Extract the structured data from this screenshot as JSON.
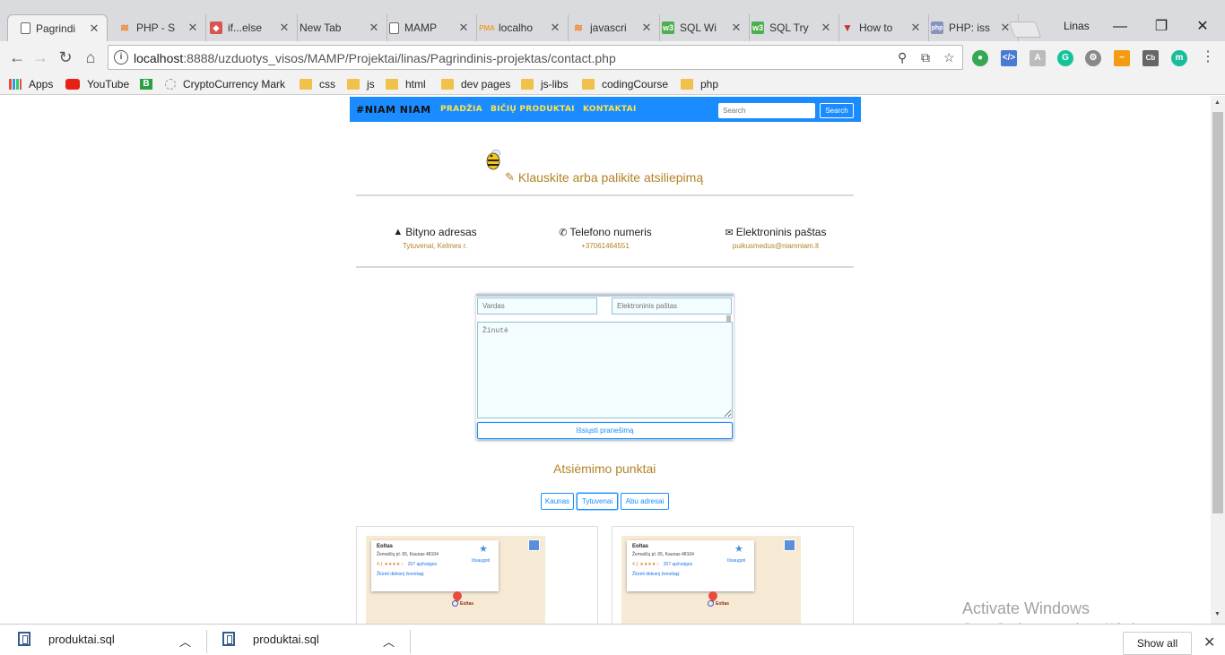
{
  "tabs": [
    {
      "title": "Pagrindi",
      "icon": "page-icon",
      "active": true
    },
    {
      "title": "PHP - S",
      "icon": "stackoverflow-icon"
    },
    {
      "title": "if...else",
      "icon": "bird-icon"
    },
    {
      "title": "New Tab",
      "icon": "none"
    },
    {
      "title": "MAMP",
      "icon": "page-icon"
    },
    {
      "title": "localho",
      "icon": "phpmyadmin-icon"
    },
    {
      "title": "javascri",
      "icon": "stackoverflow-icon"
    },
    {
      "title": "SQL Wi",
      "icon": "w3-icon"
    },
    {
      "title": "SQL Try",
      "icon": "w3-icon"
    },
    {
      "title": "How to",
      "icon": "v-icon"
    },
    {
      "title": "PHP: iss",
      "icon": "php-icon"
    }
  ],
  "window": {
    "user": "Linas",
    "minimize": "—",
    "maximize": "❐",
    "close": "✕"
  },
  "address": {
    "host": "localhost",
    "path": ":8888/uzduotys_visos/MAMP/Projektai/linas/Pagrindinis-projektas/contact.php"
  },
  "bookmarks": [
    {
      "label": "Apps",
      "icon": "apps-icon"
    },
    {
      "label": "YouTube",
      "icon": "youtube-icon"
    },
    {
      "label": "",
      "icon": "b-icon"
    },
    {
      "label": "CryptoCurrency Mark",
      "icon": "crypto-icon"
    },
    {
      "label": "css",
      "icon": "folder-icon"
    },
    {
      "label": "js",
      "icon": "folder-icon"
    },
    {
      "label": "html",
      "icon": "folder-icon"
    },
    {
      "label": "dev pages",
      "icon": "folder-icon"
    },
    {
      "label": "js-libs",
      "icon": "folder-icon"
    },
    {
      "label": "codingCourse",
      "icon": "folder-icon"
    },
    {
      "label": "php",
      "icon": "folder-icon"
    }
  ],
  "site": {
    "brand": "#NIAM NIAM",
    "nav": [
      "PRADŽIA",
      "BIČIŲ PRODUKTAI",
      "KONTAKTAI"
    ],
    "search_placeholder": "Search",
    "search_button": "Search",
    "heading": "Klauskite arba palikite atsiliepimą",
    "info": [
      {
        "label": "Bityno adresas",
        "value": "Tytuvenai, Kelmes r.",
        "icon": "road-icon"
      },
      {
        "label": "Telefono numeris",
        "value": "+37061464551",
        "icon": "phone-icon"
      },
      {
        "label": "Elektroninis paštas",
        "value": "puikusmedus@niamniam.lt",
        "icon": "envelope-icon"
      }
    ],
    "form": {
      "name_placeholder": "Vardas",
      "email_placeholder": "Elektroninis paštas",
      "message_placeholder": "Žinutė",
      "submit": "Išsiųsti pranešimą"
    },
    "pickup_title": "Atsiėmimo punktai",
    "cities": [
      "Kaunas",
      "Tytuvenai",
      "Abu adresai"
    ],
    "selected_city": "Tytuvenai",
    "maps": [
      {
        "name": "Eoltas",
        "address": "Žemaičių pl. 65, Kaunas 48104",
        "rating": "4,1 ★★★★☆",
        "reviews": "207 apžvalgos",
        "save": "Išsaugoti",
        "view": "Žiūrėti didesnį žemėlapį",
        "pin": "Eoltas"
      },
      {
        "name": "Eoltas",
        "address": "Žemaičių pl. 65, Kaunas 48104",
        "rating": "4,1 ★★★★☆",
        "reviews": "207 apžvalgos",
        "save": "Išsaugoti",
        "view": "Žiūrėti didesnį žemėlapį",
        "pin": "Eoltas"
      }
    ]
  },
  "watermark": {
    "line1": "Activate Windows",
    "line2": "Go to Settings to activate Windows."
  },
  "downloads": {
    "items": [
      "produktai.sql",
      "produktai.sql"
    ],
    "show_all": "Show all",
    "close": "✕"
  },
  "colors": {
    "brand_blue": "#1a8cff",
    "nav_yellow": "#ffe34d",
    "accent_gold": "#b38327"
  }
}
